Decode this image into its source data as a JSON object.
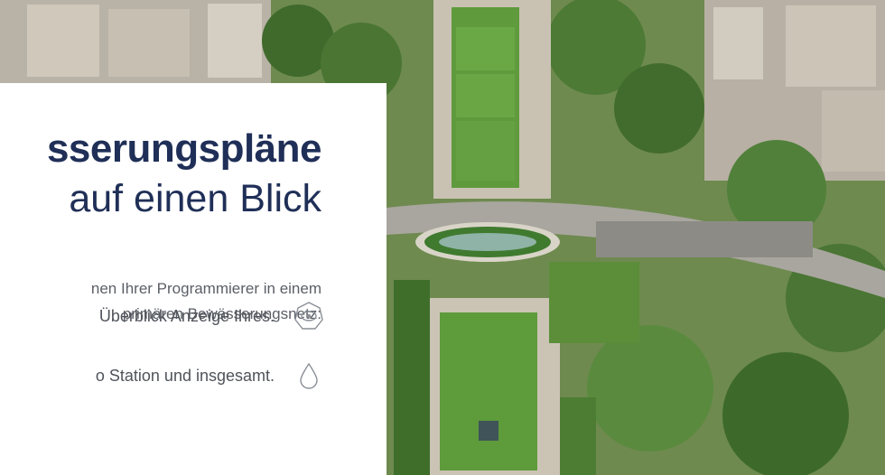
{
  "hero": {
    "title_bold": "sserungspläne",
    "title_light": "auf einen Blick",
    "intro_line1": "nen Ihrer Programmierer in einem",
    "intro_line2": "primären Bewässerungsnetz:"
  },
  "features": [
    {
      "label": "Überblick Anzeige Ihres.",
      "icon": "eye-gear-icon"
    },
    {
      "label": "o Station und insgesamt.",
      "icon": "water-drop-icon"
    }
  ],
  "colors": {
    "title": "#1f2f57",
    "body_text": "#5b5f66",
    "icon_stroke": "#8a8f96"
  }
}
